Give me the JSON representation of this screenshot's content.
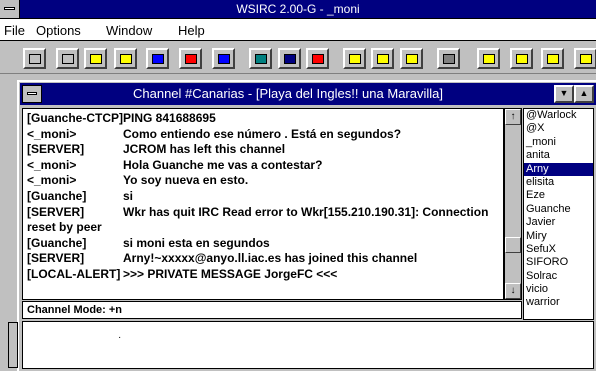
{
  "app": {
    "title": "WSIRC 2.00-G - _moni"
  },
  "menu": [
    {
      "label": "File",
      "underline": "F"
    },
    {
      "label": "Options",
      "underline": "O"
    },
    {
      "label": "Window",
      "underline": "W"
    },
    {
      "label": "Help",
      "underline": "H"
    }
  ],
  "toolbar_buttons": [
    "open",
    "connect",
    "options",
    "help",
    "join",
    "leave",
    "list",
    "dcc",
    "whois",
    "names",
    "query",
    "chat",
    "info",
    "user",
    "ignore",
    "away",
    "ping",
    "log"
  ],
  "channel": {
    "title": "Channel #Canarias - [Playa del Ingles!! una Maravilla]",
    "messages": [
      {
        "nick": "[Guanche-CTCP]",
        "text": "PING 841688695"
      },
      {
        "nick": "<_moni>",
        "text": "Como entiendo ese número . Está en segundos?"
      },
      {
        "nick": "[SERVER]",
        "text": "JCROM has left this channel"
      },
      {
        "nick": "<_moni>",
        "text": "Hola Guanche me vas a contestar?"
      },
      {
        "nick": "<_moni>",
        "text": "Yo soy nueva en esto."
      },
      {
        "nick": "[Guanche]",
        "text": "si"
      },
      {
        "nick": "[SERVER]",
        "text": "Wkr has quit IRC Read error to Wkr[155.210.190.31]: Connection reset by peer"
      },
      {
        "nick": "[Guanche]",
        "text": "si moni esta en segundos"
      },
      {
        "nick": "[SERVER]",
        "text": "Arny!~xxxxx@anyo.ll.iac.es has joined this channel"
      },
      {
        "nick": "[LOCAL-ALERT]",
        "text": ">>> PRIVATE MESSAGE JorgeFC <<<"
      }
    ],
    "mode_text": "Channel Mode: +n",
    "users": [
      "@Warlock",
      "@X",
      "_moni",
      "anita",
      "Arny",
      "elisita",
      "Eze",
      "Guanche",
      "Javier",
      "Miry",
      "SefuX",
      "SIFORO",
      "Solrac",
      "vicio",
      "warrior"
    ],
    "selected_user": "Arny"
  },
  "scroll_up": "↑",
  "scroll_down": "↓"
}
